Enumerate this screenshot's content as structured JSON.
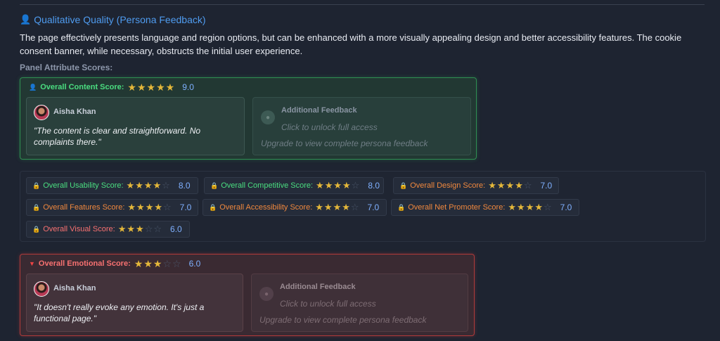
{
  "section": {
    "title": "Qualitative Quality (Persona Feedback)",
    "title_icon": "person-icon",
    "description": "The page effectively presents language and region options, but can be enhanced with a more visually appealing design and better accessibility features. The cookie consent banner, while necessary, obstructs the initial user experience.",
    "panel_label": "Panel Attribute Scores:"
  },
  "content_panel": {
    "label": "Overall Content Score:",
    "stars": 5,
    "score": "9.0",
    "persona": {
      "name": "Aisha Khan",
      "quote": "\"The content is clear and straightforward. No complaints there.\""
    },
    "locked": {
      "title": "Additional Feedback",
      "unlock_text": "Click to unlock full access",
      "upgrade_text": "Upgrade to view complete persona feedback"
    }
  },
  "scores": [
    {
      "label": "Overall Usability Score:",
      "stars": 4,
      "score": "8.0",
      "tone": "g"
    },
    {
      "label": "Overall Competitive Score:",
      "stars": 4,
      "score": "8.0",
      "tone": "g"
    },
    {
      "label": "Overall Design Score:",
      "stars": 4,
      "score": "7.0",
      "tone": "o"
    },
    {
      "label": "Overall Features Score:",
      "stars": 4,
      "score": "7.0",
      "tone": "o"
    },
    {
      "label": "Overall Accessibility Score:",
      "stars": 4,
      "score": "7.0",
      "tone": "o"
    },
    {
      "label": "Overall Net Promoter Score:",
      "stars": 4,
      "score": "7.0",
      "tone": "o"
    },
    {
      "label": "Overall Visual Score:",
      "stars": 3,
      "score": "6.0",
      "tone": "r"
    }
  ],
  "emotional_panel": {
    "label": "Overall Emotional Score:",
    "stars": 3,
    "score": "6.0",
    "persona": {
      "name": "Aisha Khan",
      "quote": "\"It doesn't really evoke any emotion. It's just a functional page.\""
    },
    "locked": {
      "title": "Additional Feedback",
      "unlock_text": "Click to unlock full access",
      "upgrade_text": "Upgrade to view complete persona feedback"
    }
  },
  "colors": {
    "accent_blue": "#4f9cf0",
    "positive_green": "#4ade80",
    "warning_orange": "#f0883e",
    "negative_red": "#f87171",
    "star_gold": "#e5b83a"
  }
}
